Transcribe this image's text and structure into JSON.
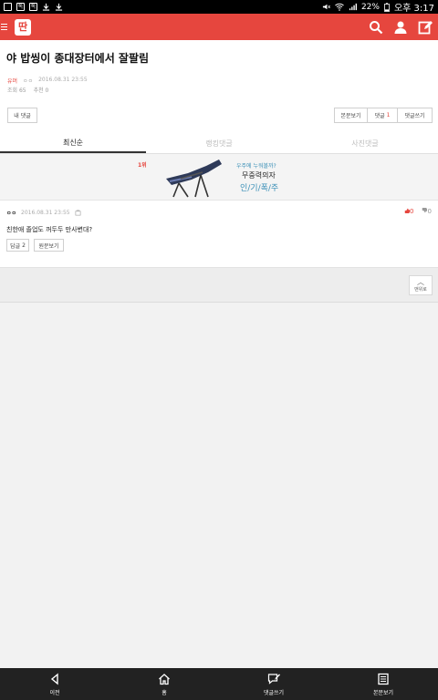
{
  "statusbar": {
    "left_icons": [
      "image-icon",
      "notification-icon",
      "notification-icon",
      "download-icon",
      "download-icon"
    ],
    "battery": "22%",
    "time": "오후 3:17"
  },
  "appbar": {
    "logo_text": "딴",
    "bg_color": "#e6463e",
    "icons": [
      "search-icon",
      "user-icon",
      "edit-icon"
    ]
  },
  "post": {
    "title": "야 밥씽이 종대장터에서 잘팔림",
    "board": "유머",
    "author": "ㅇㅇ",
    "date": "2016.08.31 23:55",
    "views_label": "조회 65",
    "recommend_label": "추천 0"
  },
  "buttons": {
    "my_comments": "내 댓글",
    "view_original": "본문보기",
    "comments_label": "댓글",
    "comments_count": "1",
    "write_comment": "댓글쓰기"
  },
  "tabs": [
    {
      "label": "최신순"
    },
    {
      "label": "랭킹댓글"
    },
    {
      "label": "사진댓글"
    }
  ],
  "ad": {
    "rank": "1위",
    "text1": "우주에 누워볼까?",
    "text2": "무중력의자",
    "text3": "인/기/폭/주"
  },
  "comment": {
    "nick": "ㅇㅇ",
    "date": "2016.08.31 23:55",
    "upvotes": "0",
    "downvotes": "0",
    "text": "친한애 졸업도 꺼두두 만사변대?",
    "reply_label": "답글",
    "reply_count": "2",
    "original_label": "원문보기"
  },
  "to_top_label": "맨위로",
  "bottombar": {
    "items": [
      {
        "label": "이전",
        "icon": "back-icon"
      },
      {
        "label": "홈",
        "icon": "home-icon"
      },
      {
        "label": "댓글쓰기",
        "icon": "comment-write-icon"
      },
      {
        "label": "본문보기",
        "icon": "article-icon"
      }
    ]
  }
}
